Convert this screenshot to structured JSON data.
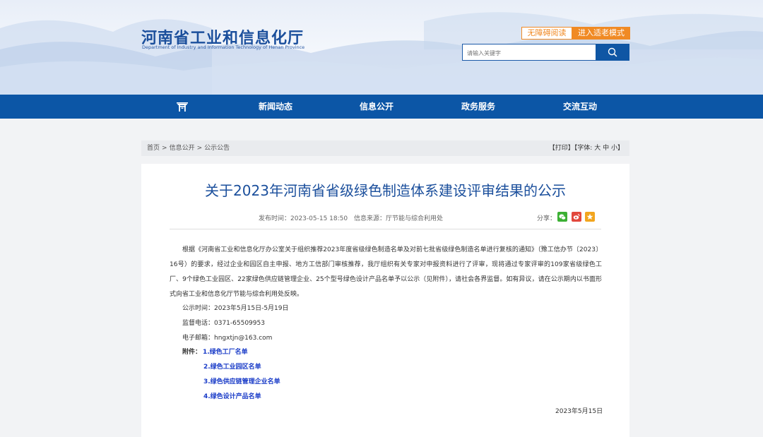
{
  "header": {
    "title": "河南省工业和信息化厅",
    "subtitle": "Department of Industry and Information Technology of Henan Province",
    "accessible_label": "无障碍阅读",
    "elder_mode_label": "进入适老模式",
    "search_placeholder": "请输入关键字"
  },
  "nav": {
    "items": [
      "新闻动态",
      "信息公开",
      "政务服务",
      "交流互动"
    ]
  },
  "breadcrumb": {
    "items": [
      "首页",
      "信息公开",
      "公示公告"
    ],
    "separator": ">"
  },
  "tools": {
    "print": "【打印】",
    "font_prefix": "【字体:",
    "font_large": "大",
    "font_medium": "中",
    "font_small": "小",
    "font_suffix": "】"
  },
  "article": {
    "title": "关于2023年河南省省级绿色制造体系建设评审结果的公示",
    "publish_time": "发布时间：2023-05-15 18:50",
    "source": "信息来源：厅节能与综合利用处",
    "share_label": "分享：",
    "body": "根据《河南省工业和信息化厅办公室关于组织推荐2023年度省级绿色制造名单及对前七批省级绿色制造名单进行复核的通知》（豫工信办节〔2023〕16号）的要求，经过企业和园区自主申报、地方工信部门审核推荐，我厅组织有关专家对申报资料进行了评审，现将通过专家评审的109家省级绿色工厂、9个绿色工业园区、22家绿色供应链管理企业、25个型号绿色设计产品名单予以公示（见附件），请社会各界监督。如有异议，请在公示期内以书面形式向省工业和信息化厅节能与综合利用处反映。",
    "period": "公示时间：2023年5月15日-5月19日",
    "phone": "监督电话：0371-65509953",
    "email": "电子邮箱：hngxtjn@163.com",
    "attachment_label": "附件：",
    "attachments": [
      "1.绿色工厂名单",
      "2.绿色工业园区名单",
      "3.绿色供应链管理企业名单",
      "4.绿色设计产品名单"
    ],
    "date": "2023年5月15日"
  },
  "colors": {
    "brand_blue": "#0c56a6",
    "accent_orange": "#f08a24",
    "title_blue": "#1b4f9c",
    "link_blue": "#1a3cc8"
  }
}
